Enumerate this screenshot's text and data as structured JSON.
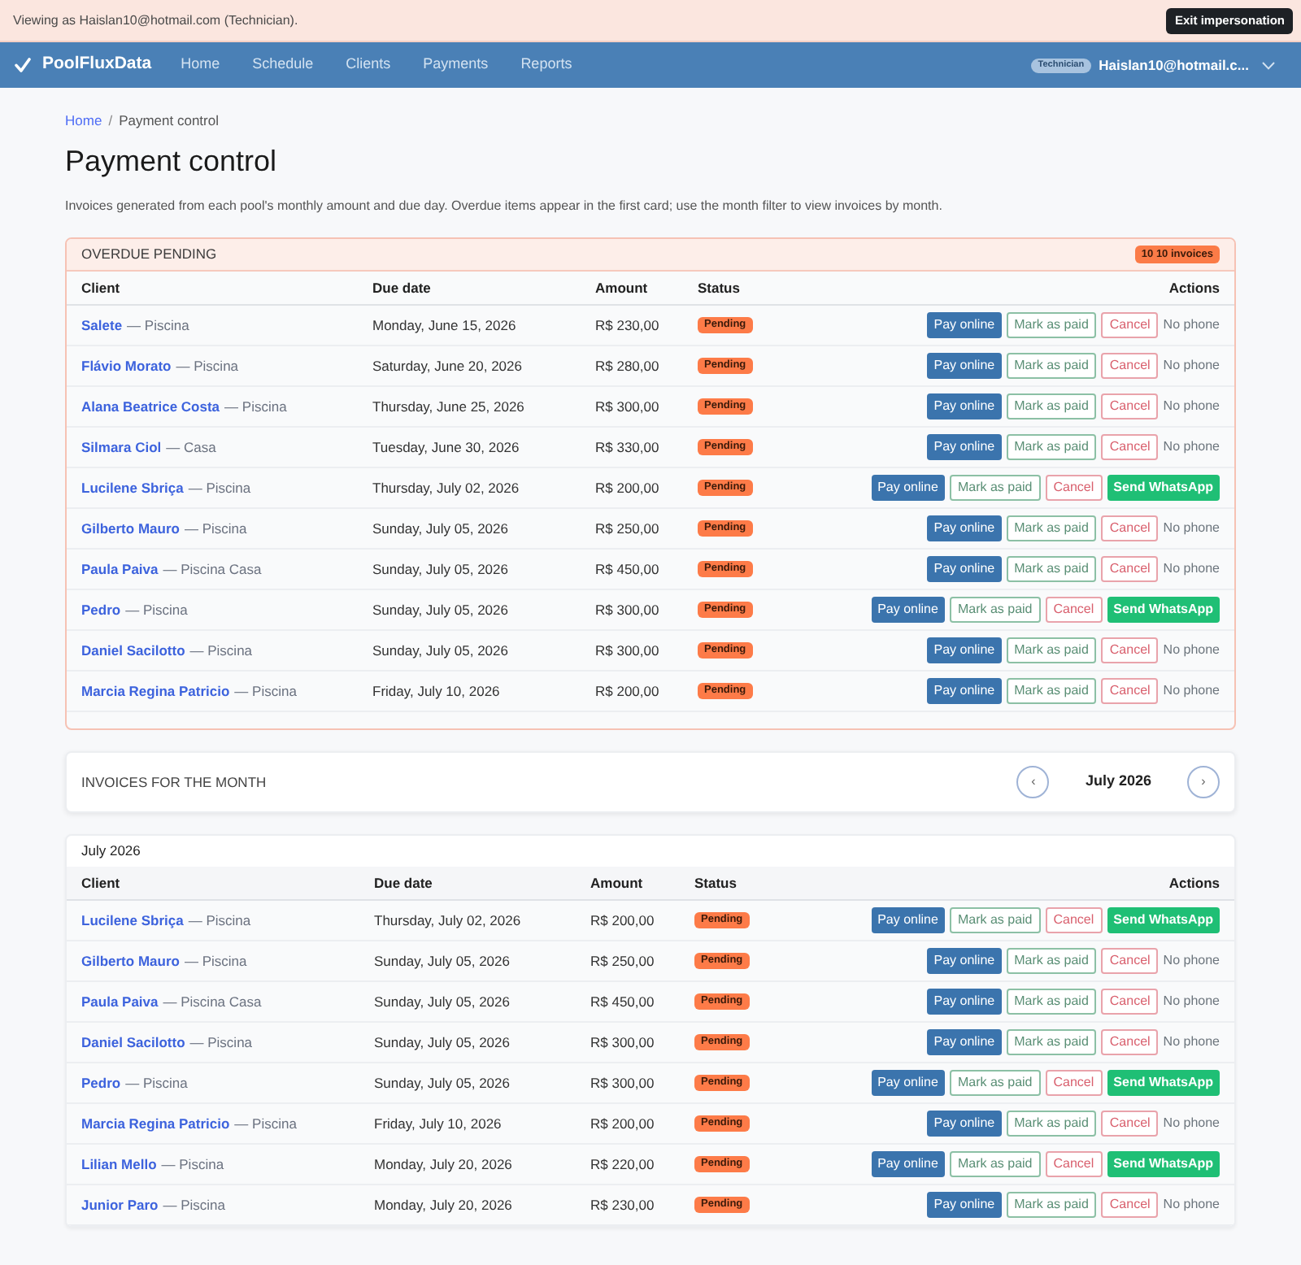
{
  "impersonation_banner": {
    "text": "Viewing as Haislan10@hotmail.com (Technician).",
    "button": "Exit impersonation"
  },
  "navbar": {
    "brand": "PoolFluxData",
    "links": [
      {
        "label": "Home"
      },
      {
        "label": "Schedule"
      },
      {
        "label": "Clients"
      },
      {
        "label": "Payments"
      },
      {
        "label": "Reports"
      }
    ],
    "user": {
      "role_badge": "Technician",
      "email": "Haislan10@hotmail.c..."
    }
  },
  "breadcrumb": {
    "items": [
      {
        "label": "Home",
        "kind": "link"
      },
      {
        "label": "Payment control",
        "kind": "current"
      }
    ],
    "separator": "/"
  },
  "page": {
    "title": "Payment control",
    "description": "Invoices generated from each pool's monthly amount and due day. Overdue items appear in the first card; use the month filter to view invoices by month."
  },
  "overdue_card": {
    "title": "OVERDUE PENDING",
    "badge": "10 10 invoices",
    "columns": [
      "Client",
      "Due date",
      "Amount",
      "Status",
      "Actions"
    ],
    "rows": [
      {
        "client": "Salete",
        "pool": "— Piscina",
        "due_date": "Monday, June 15, 2026",
        "amount": "R$ 230,00",
        "status": "Pending",
        "actions": [
          {
            "kind": "pay",
            "label": "Pay online"
          },
          {
            "kind": "mark_paid",
            "label": "Mark as paid"
          },
          {
            "kind": "cancel",
            "label": "Cancel"
          },
          {
            "kind": "note",
            "label": "No phone"
          }
        ]
      },
      {
        "client": "Flávio Morato",
        "pool": "— Piscina",
        "due_date": "Saturday, June 20, 2026",
        "amount": "R$ 280,00",
        "status": "Pending",
        "actions": [
          {
            "kind": "pay",
            "label": "Pay online"
          },
          {
            "kind": "mark_paid",
            "label": "Mark as paid"
          },
          {
            "kind": "cancel",
            "label": "Cancel"
          },
          {
            "kind": "note",
            "label": "No phone"
          }
        ]
      },
      {
        "client": "Alana Beatrice Costa",
        "pool": "— Piscina",
        "due_date": "Thursday, June 25, 2026",
        "amount": "R$ 300,00",
        "status": "Pending",
        "actions": [
          {
            "kind": "pay",
            "label": "Pay online"
          },
          {
            "kind": "mark_paid",
            "label": "Mark as paid"
          },
          {
            "kind": "cancel",
            "label": "Cancel"
          },
          {
            "kind": "note",
            "label": "No phone"
          }
        ]
      },
      {
        "client": "Silmara Ciol",
        "pool": "— Casa",
        "due_date": "Tuesday, June 30, 2026",
        "amount": "R$ 330,00",
        "status": "Pending",
        "actions": [
          {
            "kind": "pay",
            "label": "Pay online"
          },
          {
            "kind": "mark_paid",
            "label": "Mark as paid"
          },
          {
            "kind": "cancel",
            "label": "Cancel"
          },
          {
            "kind": "note",
            "label": "No phone"
          }
        ]
      },
      {
        "client": "Lucilene Sbriça",
        "pool": "— Piscina",
        "due_date": "Thursday, July 02, 2026",
        "amount": "R$ 200,00",
        "status": "Pending",
        "actions": [
          {
            "kind": "pay",
            "label": "Pay online"
          },
          {
            "kind": "mark_paid",
            "label": "Mark as paid"
          },
          {
            "kind": "cancel",
            "label": "Cancel"
          },
          {
            "kind": "whatsapp",
            "label": "Send WhatsApp"
          }
        ]
      },
      {
        "client": "Gilberto Mauro",
        "pool": "— Piscina",
        "due_date": "Sunday, July 05, 2026",
        "amount": "R$ 250,00",
        "status": "Pending",
        "actions": [
          {
            "kind": "pay",
            "label": "Pay online"
          },
          {
            "kind": "mark_paid",
            "label": "Mark as paid"
          },
          {
            "kind": "cancel",
            "label": "Cancel"
          },
          {
            "kind": "note",
            "label": "No phone"
          }
        ]
      },
      {
        "client": "Paula Paiva",
        "pool": "— Piscina Casa",
        "due_date": "Sunday, July 05, 2026",
        "amount": "R$ 450,00",
        "status": "Pending",
        "actions": [
          {
            "kind": "pay",
            "label": "Pay online"
          },
          {
            "kind": "mark_paid",
            "label": "Mark as paid"
          },
          {
            "kind": "cancel",
            "label": "Cancel"
          },
          {
            "kind": "note",
            "label": "No phone"
          }
        ]
      },
      {
        "client": "Pedro",
        "pool": "— Piscina",
        "due_date": "Sunday, July 05, 2026",
        "amount": "R$ 300,00",
        "status": "Pending",
        "actions": [
          {
            "kind": "pay",
            "label": "Pay online"
          },
          {
            "kind": "mark_paid",
            "label": "Mark as paid"
          },
          {
            "kind": "cancel",
            "label": "Cancel"
          },
          {
            "kind": "whatsapp",
            "label": "Send WhatsApp"
          }
        ]
      },
      {
        "client": "Daniel Sacilotto",
        "pool": "— Piscina",
        "due_date": "Sunday, July 05, 2026",
        "amount": "R$ 300,00",
        "status": "Pending",
        "actions": [
          {
            "kind": "pay",
            "label": "Pay online"
          },
          {
            "kind": "mark_paid",
            "label": "Mark as paid"
          },
          {
            "kind": "cancel",
            "label": "Cancel"
          },
          {
            "kind": "note",
            "label": "No phone"
          }
        ]
      },
      {
        "client": "Marcia Regina Patricio",
        "pool": "— Piscina",
        "due_date": "Friday, July 10, 2026",
        "amount": "R$ 200,00",
        "status": "Pending",
        "actions": [
          {
            "kind": "pay",
            "label": "Pay online"
          },
          {
            "kind": "mark_paid",
            "label": "Mark as paid"
          },
          {
            "kind": "cancel",
            "label": "Cancel"
          },
          {
            "kind": "note",
            "label": "No phone"
          }
        ]
      }
    ]
  },
  "month_filter": {
    "title": "INVOICES FOR THE MONTH",
    "prev_button": "‹",
    "month": "July 2026",
    "next_button": "›"
  },
  "month_card": {
    "title": "July 2026",
    "columns": [
      "Client",
      "Due date",
      "Amount",
      "Status",
      "Actions"
    ],
    "rows": [
      {
        "client": "Lucilene Sbriça",
        "pool": "— Piscina",
        "due_date": "Thursday, July 02, 2026",
        "amount": "R$ 200,00",
        "status": "Pending",
        "actions": [
          {
            "kind": "pay",
            "label": "Pay online"
          },
          {
            "kind": "mark_paid",
            "label": "Mark as paid"
          },
          {
            "kind": "cancel",
            "label": "Cancel"
          },
          {
            "kind": "whatsapp",
            "label": "Send WhatsApp"
          }
        ]
      },
      {
        "client": "Gilberto Mauro",
        "pool": "— Piscina",
        "due_date": "Sunday, July 05, 2026",
        "amount": "R$ 250,00",
        "status": "Pending",
        "actions": [
          {
            "kind": "pay",
            "label": "Pay online"
          },
          {
            "kind": "mark_paid",
            "label": "Mark as paid"
          },
          {
            "kind": "cancel",
            "label": "Cancel"
          },
          {
            "kind": "note",
            "label": "No phone"
          }
        ]
      },
      {
        "client": "Paula Paiva",
        "pool": "— Piscina Casa",
        "due_date": "Sunday, July 05, 2026",
        "amount": "R$ 450,00",
        "status": "Pending",
        "actions": [
          {
            "kind": "pay",
            "label": "Pay online"
          },
          {
            "kind": "mark_paid",
            "label": "Mark as paid"
          },
          {
            "kind": "cancel",
            "label": "Cancel"
          },
          {
            "kind": "note",
            "label": "No phone"
          }
        ]
      },
      {
        "client": "Daniel Sacilotto",
        "pool": "— Piscina",
        "due_date": "Sunday, July 05, 2026",
        "amount": "R$ 300,00",
        "status": "Pending",
        "actions": [
          {
            "kind": "pay",
            "label": "Pay online"
          },
          {
            "kind": "mark_paid",
            "label": "Mark as paid"
          },
          {
            "kind": "cancel",
            "label": "Cancel"
          },
          {
            "kind": "note",
            "label": "No phone"
          }
        ]
      },
      {
        "client": "Pedro",
        "pool": "— Piscina",
        "due_date": "Sunday, July 05, 2026",
        "amount": "R$ 300,00",
        "status": "Pending",
        "actions": [
          {
            "kind": "pay",
            "label": "Pay online"
          },
          {
            "kind": "mark_paid",
            "label": "Mark as paid"
          },
          {
            "kind": "cancel",
            "label": "Cancel"
          },
          {
            "kind": "whatsapp",
            "label": "Send WhatsApp"
          }
        ]
      },
      {
        "client": "Marcia Regina Patricio",
        "pool": "— Piscina",
        "due_date": "Friday, July 10, 2026",
        "amount": "R$ 200,00",
        "status": "Pending",
        "actions": [
          {
            "kind": "pay",
            "label": "Pay online"
          },
          {
            "kind": "mark_paid",
            "label": "Mark as paid"
          },
          {
            "kind": "cancel",
            "label": "Cancel"
          },
          {
            "kind": "note",
            "label": "No phone"
          }
        ]
      },
      {
        "client": "Lilian Mello",
        "pool": "— Piscina",
        "due_date": "Monday, July 20, 2026",
        "amount": "R$ 220,00",
        "status": "Pending",
        "actions": [
          {
            "kind": "pay",
            "label": "Pay online"
          },
          {
            "kind": "mark_paid",
            "label": "Mark as paid"
          },
          {
            "kind": "cancel",
            "label": "Cancel"
          },
          {
            "kind": "whatsapp",
            "label": "Send WhatsApp"
          }
        ]
      },
      {
        "client": "Junior Paro",
        "pool": "— Piscina",
        "due_date": "Monday, July 20, 2026",
        "amount": "R$ 230,00",
        "status": "Pending",
        "actions": [
          {
            "kind": "pay",
            "label": "Pay online"
          },
          {
            "kind": "mark_paid",
            "label": "Mark as paid"
          },
          {
            "kind": "cancel",
            "label": "Cancel"
          },
          {
            "kind": "note",
            "label": "No phone"
          }
        ]
      }
    ]
  }
}
